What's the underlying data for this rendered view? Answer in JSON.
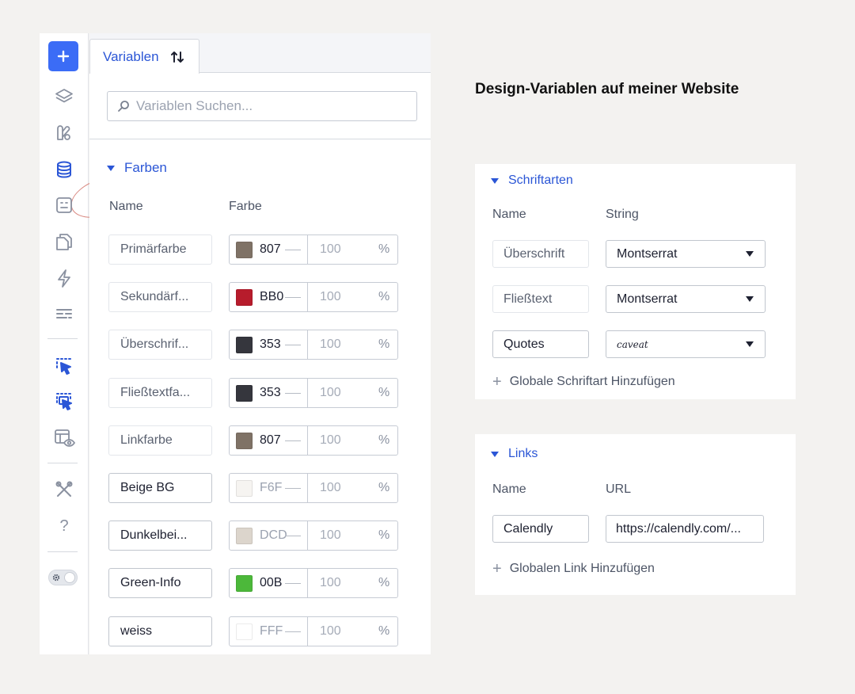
{
  "toolbar": {
    "items": [
      {
        "name": "layers-icon"
      },
      {
        "name": "paint-icon"
      },
      {
        "name": "database-icon"
      },
      {
        "name": "template-icon"
      },
      {
        "name": "pages-icon"
      },
      {
        "name": "lightning-icon"
      },
      {
        "name": "forms-icon"
      },
      {
        "name": "select-icon"
      },
      {
        "name": "multi-select-icon"
      },
      {
        "name": "preview-icon"
      },
      {
        "name": "tools-icon"
      },
      {
        "name": "help-icon"
      }
    ],
    "help_label": "?"
  },
  "panel": {
    "tab_label": "Variablen",
    "search_placeholder": "Variablen Suchen...",
    "section_title": "Farben",
    "col_name": "Name",
    "col_color": "Farbe",
    "rows": [
      {
        "name": "Primärfarbe",
        "hex": "807",
        "color": "#7f7266",
        "opacity": "100",
        "pct": "%",
        "strong": false
      },
      {
        "name": "Sekundärf...",
        "hex": "BB0",
        "color": "#b71c2c",
        "opacity": "100",
        "pct": "%",
        "strong": false
      },
      {
        "name": "Überschrif...",
        "hex": "353",
        "color": "#35363d",
        "opacity": "100",
        "pct": "%",
        "strong": false
      },
      {
        "name": "Fließtextfa...",
        "hex": "353",
        "color": "#35363d",
        "opacity": "100",
        "pct": "%",
        "strong": false
      },
      {
        "name": "Linkfarbe",
        "hex": "807",
        "color": "#7f7266",
        "opacity": "100",
        "pct": "%",
        "strong": false
      },
      {
        "name": "Beige BG",
        "hex": "F6F",
        "color": "#f6f4f1",
        "opacity": "100",
        "pct": "%",
        "strong": true
      },
      {
        "name": "Dunkelbei...",
        "hex": "DCD",
        "color": "#dcd5cc",
        "opacity": "100",
        "pct": "%",
        "strong": true
      },
      {
        "name": "Green-Info",
        "hex": "00B",
        "color": "#4cb83a",
        "opacity": "100",
        "pct": "%",
        "strong": true
      },
      {
        "name": "weiss",
        "hex": "FFF",
        "color": "#ffffff",
        "opacity": "100",
        "pct": "%",
        "strong": true
      }
    ]
  },
  "heading": "Design-Variablen auf meiner Website",
  "fonts_card": {
    "title": "Schriftarten",
    "col_name": "Name",
    "col_type": "String",
    "rows": [
      {
        "name": "Überschrift",
        "value": "Montserrat",
        "strong": false,
        "script": false
      },
      {
        "name": "Fließtext",
        "value": "Montserrat",
        "strong": false,
        "script": false
      },
      {
        "name": "Quotes",
        "value": "caveat",
        "strong": true,
        "script": true
      }
    ],
    "add_label": "Globale Schriftart Hinzufügen"
  },
  "links_card": {
    "title": "Links",
    "col_name": "Name",
    "col_url": "URL",
    "row": {
      "name": "Calendly",
      "url": "https://calendly.com/..."
    },
    "add_label": "Globalen Link Hinzufügen"
  },
  "colors": {
    "accent": "#3b6cf6",
    "link_blue": "#2b56d6",
    "icon_blue": "#2b56d6",
    "icon_gray": "#8a91a0"
  }
}
